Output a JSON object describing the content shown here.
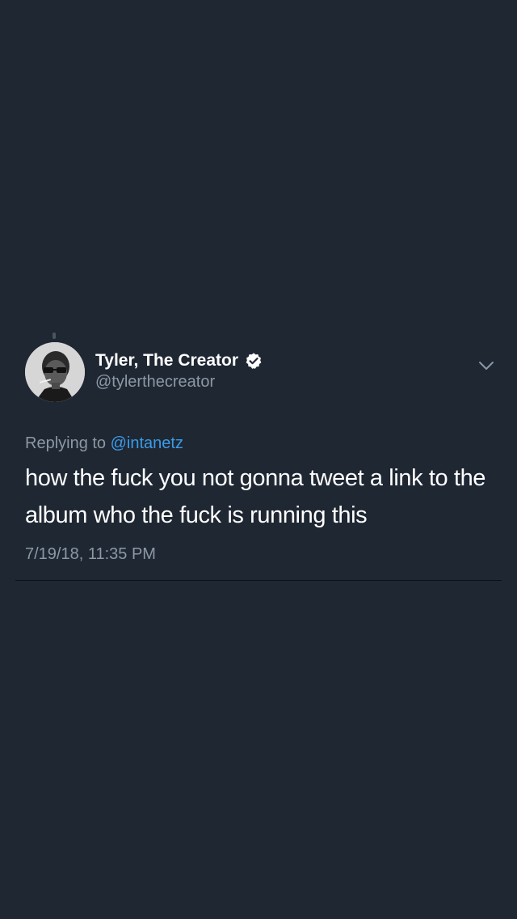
{
  "tweet": {
    "author": {
      "display_name": "Tyler, The Creator",
      "handle": "@tylerthecreator",
      "verified": true
    },
    "reply": {
      "prefix": "Replying to",
      "mention": "@intanetz"
    },
    "text": "how the fuck you not gonna tweet a link to the album who the fuck is running this",
    "timestamp": "7/19/18, 11:35 PM"
  },
  "icons": {
    "verified": "verified-badge-icon",
    "menu": "chevron-down-icon"
  },
  "colors": {
    "background": "#1f2733",
    "secondary_text": "#8b98a5",
    "link": "#3a9ce8",
    "divider": "#0d1116"
  }
}
